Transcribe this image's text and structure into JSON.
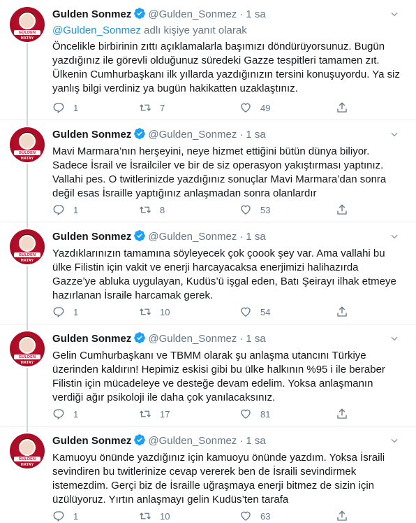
{
  "colors": {
    "name": "#14171a",
    "muted": "#657786",
    "link": "#1b95e0",
    "verified": "#1da1f2",
    "divider": "#e6ecf0",
    "avatar_bg": "#c8102e"
  },
  "tweets": [
    {
      "name": "Gulden Sonmez",
      "handle": "@Gulden_Sonmez",
      "dot": "·",
      "time": "1 sa",
      "reply_handle": "@Gulden_Sonmez",
      "reply_suffix": " adlı kişiye yanıt olarak",
      "text": "Öncelikle birbirinin zıttı açıklamalarla başımızı döndürüyorsunuz. Bugün yazdığınız ile görevli olduğunuz süredeki Gazze tespitleri tamamen zıt. Ülkenin Cumhurbaşkanı  ilk yıllarda yazdığınızın tersini konuşuyordu. Ya siz yanlış bilgi verdiniz ya bugün hakikatten uzaklaştınız.",
      "replies": "1",
      "retweets": "7",
      "likes": "49",
      "avatar_lines": [
        "GÜLDEN SÖNMEZ",
        "HATAY"
      ]
    },
    {
      "name": "Gulden Sonmez",
      "handle": "@Gulden_Sonmez",
      "dot": "·",
      "time": "1 sa",
      "text": "Mavi Marmara’nın herşeyini, neye hizmet ettiğini bütün dünya biliyor. Sadece İsrail ve İsrailciler ve bir de siz operasyon yakıştırması yaptınız. Vallahi pes. O twitlerinizde yazdığınız sonuçlar Mavi Marmara’dan sonra değil esas İsraille yaptığınız anlaşmadan sonra olanlardır",
      "replies": "1",
      "retweets": "8",
      "likes": "53",
      "avatar_lines": [
        "GÜLDEN SÖNMEZ",
        "HATAY"
      ]
    },
    {
      "name": "Gulden Sonmez",
      "handle": "@Gulden_Sonmez",
      "dot": "·",
      "time": "1 sa",
      "text": "Yazdıklarınızın tamamına söyleyecek çok çoook şey var. Ama vallahi bu ülke Filistin için vakit ve enerji harcayacaksa enerjimizi halihazırda Gazze’ye abluka uygulayan, Kudüs’ü işgal eden, Batı Şeirayı ilhak etmeye hazırlanan İsraile harcamak gerek.",
      "replies": "1",
      "retweets": "10",
      "likes": "54",
      "avatar_lines": [
        "GÜLDEN SÖNMEZ",
        "HATAY"
      ]
    },
    {
      "name": "Gulden Sonmez",
      "handle": "@Gulden_Sonmez",
      "dot": "·",
      "time": "1 sa",
      "text": "Gelin Cumhurbaşkanı ve TBMM olarak şu anlaşma utancını Türkiye üzerinden kaldırın! Hepimiz eskisi gibi bu ülke halkının %95 i ile beraber Filistin için mücadeleye ve desteğe devam edelim. Yoksa anlaşmanın verdiği ağır psikoloji ile daha çok yanılacaksınız.",
      "replies": "1",
      "retweets": "17",
      "likes": "81",
      "avatar_lines": [
        "GÜLDEN SÖNMEZ",
        "HATAY"
      ]
    },
    {
      "name": "Gulden Sonmez",
      "handle": "@Gulden_Sonmez",
      "dot": "·",
      "time": "1 sa",
      "text": "Kamuoyu önünde yazdığınız için kamuoyu önünde yazdım. Yoksa İsraili sevindiren bu twitlerinize cevap vererek ben de İsraili sevindirmek istemezdim. Gerçi biz de İsraille uğraşmaya enerji bitmez de sizin için üzülüyoruz. Yırtın anlaşmayı gelin Kudüs’ten tarafa",
      "replies": "1",
      "retweets": "10",
      "likes": "63",
      "avatar_lines": [
        "GÜLDEN SÖNMEZ",
        "HATAY"
      ]
    }
  ]
}
